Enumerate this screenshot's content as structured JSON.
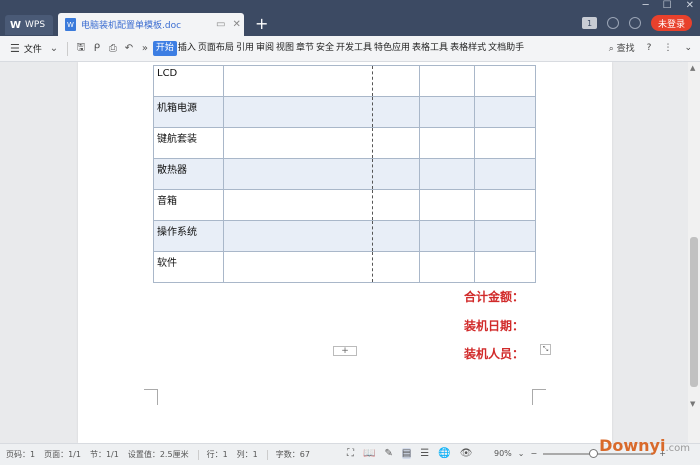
{
  "titlebar": {
    "app_tab": "WPS",
    "doc_tab_title": "电脑装机配置单模板.doc",
    "doc_icon_glyph": "W",
    "login_label": "未登录",
    "badge_label": "1"
  },
  "ribbon": {
    "file_label": "文件",
    "tabs": [
      "开始",
      "插入",
      "页面布局",
      "引用",
      "审阅",
      "视图",
      "章节",
      "安全",
      "开发工具",
      "特色应用",
      "表格工具",
      "表格样式",
      "文档助手"
    ],
    "search_label": "查找",
    "more_label": "»"
  },
  "table": {
    "rows": [
      "LCD",
      "机箱电源",
      "键航套装",
      "散热器",
      "音箱",
      "操作系统",
      "软件"
    ]
  },
  "summary": {
    "total": "合计金额：",
    "date": "装机日期：",
    "person": "装机人员："
  },
  "statusbar": {
    "page_num": "页码：1",
    "page": "页面：1/1",
    "section": "节：1/1",
    "setting": "设置值：2.5厘米",
    "row": "行：1",
    "col": "列：1",
    "word_count": "字数：67",
    "zoom": "90%",
    "zoom_fraction": 0.45
  },
  "watermark": {
    "text": "Downyi",
    "suffix": ".com"
  },
  "colors": {
    "titlebar": "#3c4a63",
    "accent": "#3d7ee3",
    "summary_text": "#d12a2a",
    "login": "#e8412c"
  }
}
